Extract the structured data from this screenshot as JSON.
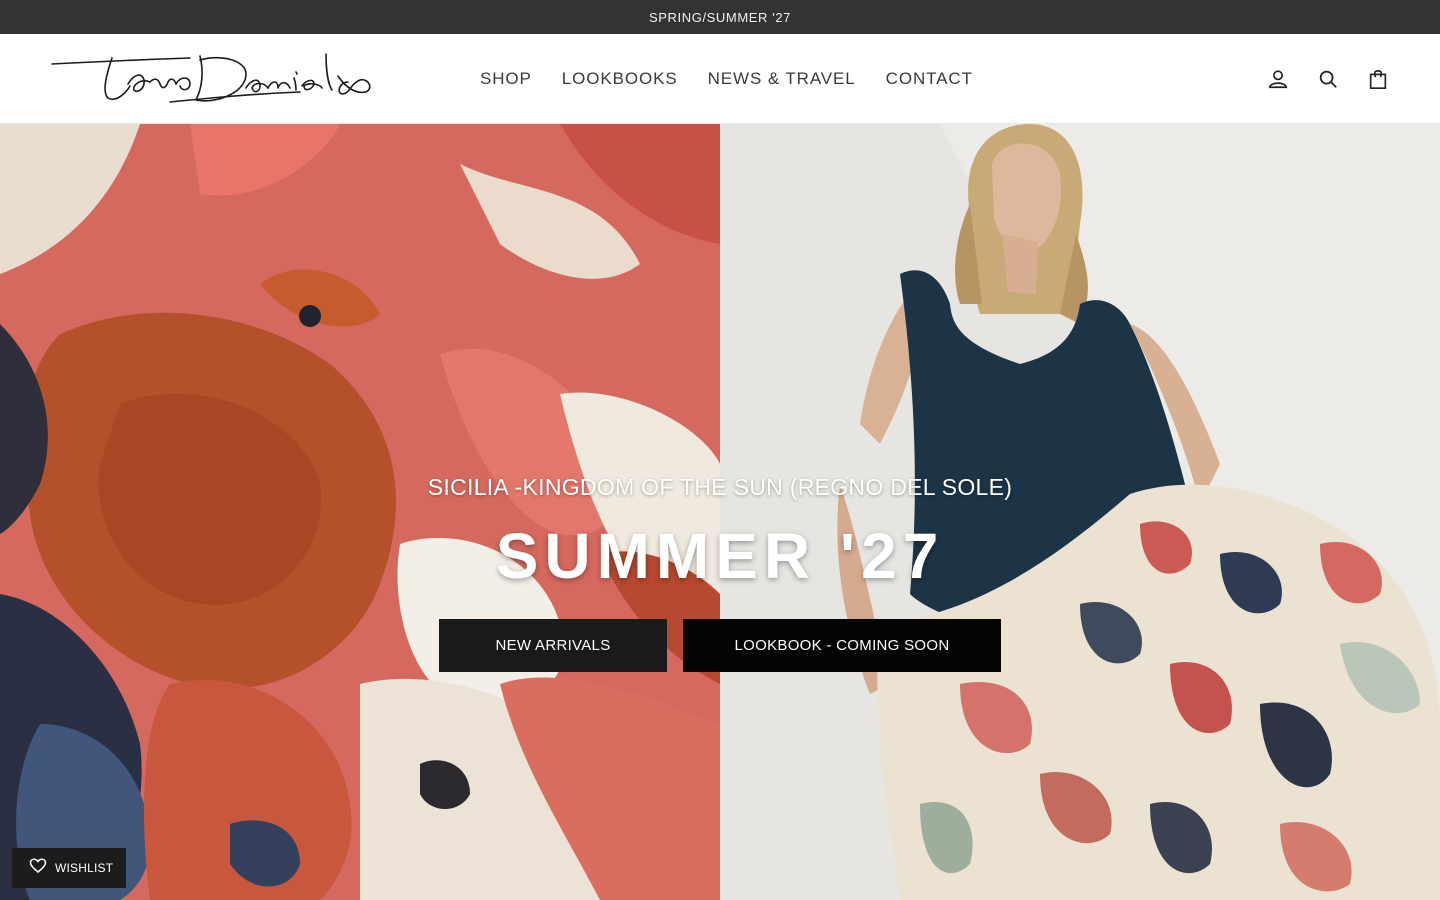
{
  "announcement": {
    "text": "SPRING/SUMMER '27"
  },
  "header": {
    "logo_alt": "Jane Daniels",
    "nav": [
      {
        "label": "SHOP"
      },
      {
        "label": "LOOKBOOKS"
      },
      {
        "label": "NEWS & TRAVEL"
      },
      {
        "label": "CONTACT"
      }
    ],
    "icons": [
      "account-icon",
      "search-icon",
      "shopping-bag-icon"
    ]
  },
  "hero": {
    "subtitle": "SICILIA -KINGDOM OF THE SUN (REGNO DEL SOLE)",
    "title": "SUMMER '27",
    "cta_primary": "NEW ARRIVALS",
    "cta_secondary": "LOOKBOOK - COMING SOON"
  },
  "wishlist": {
    "label": "WISHLIST",
    "icon": "heart-icon"
  },
  "colors": {
    "announcement_bg": "#333333",
    "button_bg": "#121212",
    "text": "#2a2a2a"
  }
}
